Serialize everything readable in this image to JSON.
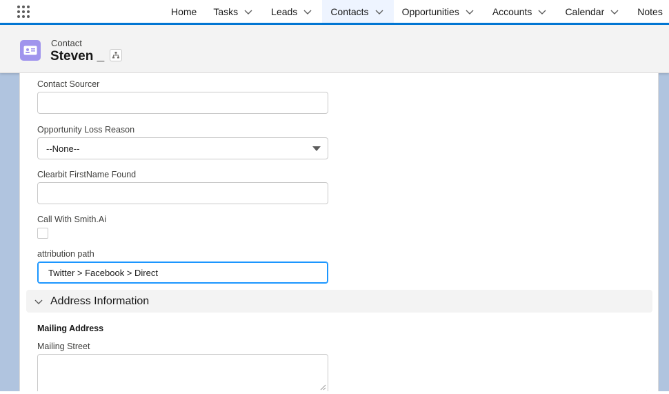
{
  "nav": {
    "items": [
      {
        "label": "Home",
        "has_menu": false,
        "active": false
      },
      {
        "label": "Tasks",
        "has_menu": true,
        "active": false
      },
      {
        "label": "Leads",
        "has_menu": true,
        "active": false
      },
      {
        "label": "Contacts",
        "has_menu": true,
        "active": true
      },
      {
        "label": "Opportunities",
        "has_menu": true,
        "active": false
      },
      {
        "label": "Accounts",
        "has_menu": true,
        "active": false
      },
      {
        "label": "Calendar",
        "has_menu": true,
        "active": false
      },
      {
        "label": "Notes",
        "has_menu": false,
        "active": false
      }
    ],
    "launcher_icon": "app-launcher-grid-icon"
  },
  "record": {
    "type_label": "Contact",
    "name": "Steven _",
    "icon": "contact-card-icon",
    "hierarchy_icon": "hierarchy-icon",
    "icon_color": "#a094ed"
  },
  "fields": {
    "contact_sourcer": {
      "label": "Contact Sourcer",
      "value": ""
    },
    "opportunity_loss_reason": {
      "label": "Opportunity Loss Reason",
      "value": "--None--"
    },
    "clearbit_firstname": {
      "label": "Clearbit FirstName Found",
      "value": ""
    },
    "call_with_smith": {
      "label": "Call With Smith.Ai",
      "checked": false
    },
    "attribution_path": {
      "label": "attribution path",
      "value": "Twitter > Facebook > Direct"
    }
  },
  "address_section": {
    "title": "Address Information",
    "mailing_heading": "Mailing Address",
    "mailing_street": {
      "label": "Mailing Street",
      "value": ""
    }
  },
  "colors": {
    "accent": "#0176d3",
    "focus": "#1b96ff",
    "background": "#b0c4df"
  }
}
